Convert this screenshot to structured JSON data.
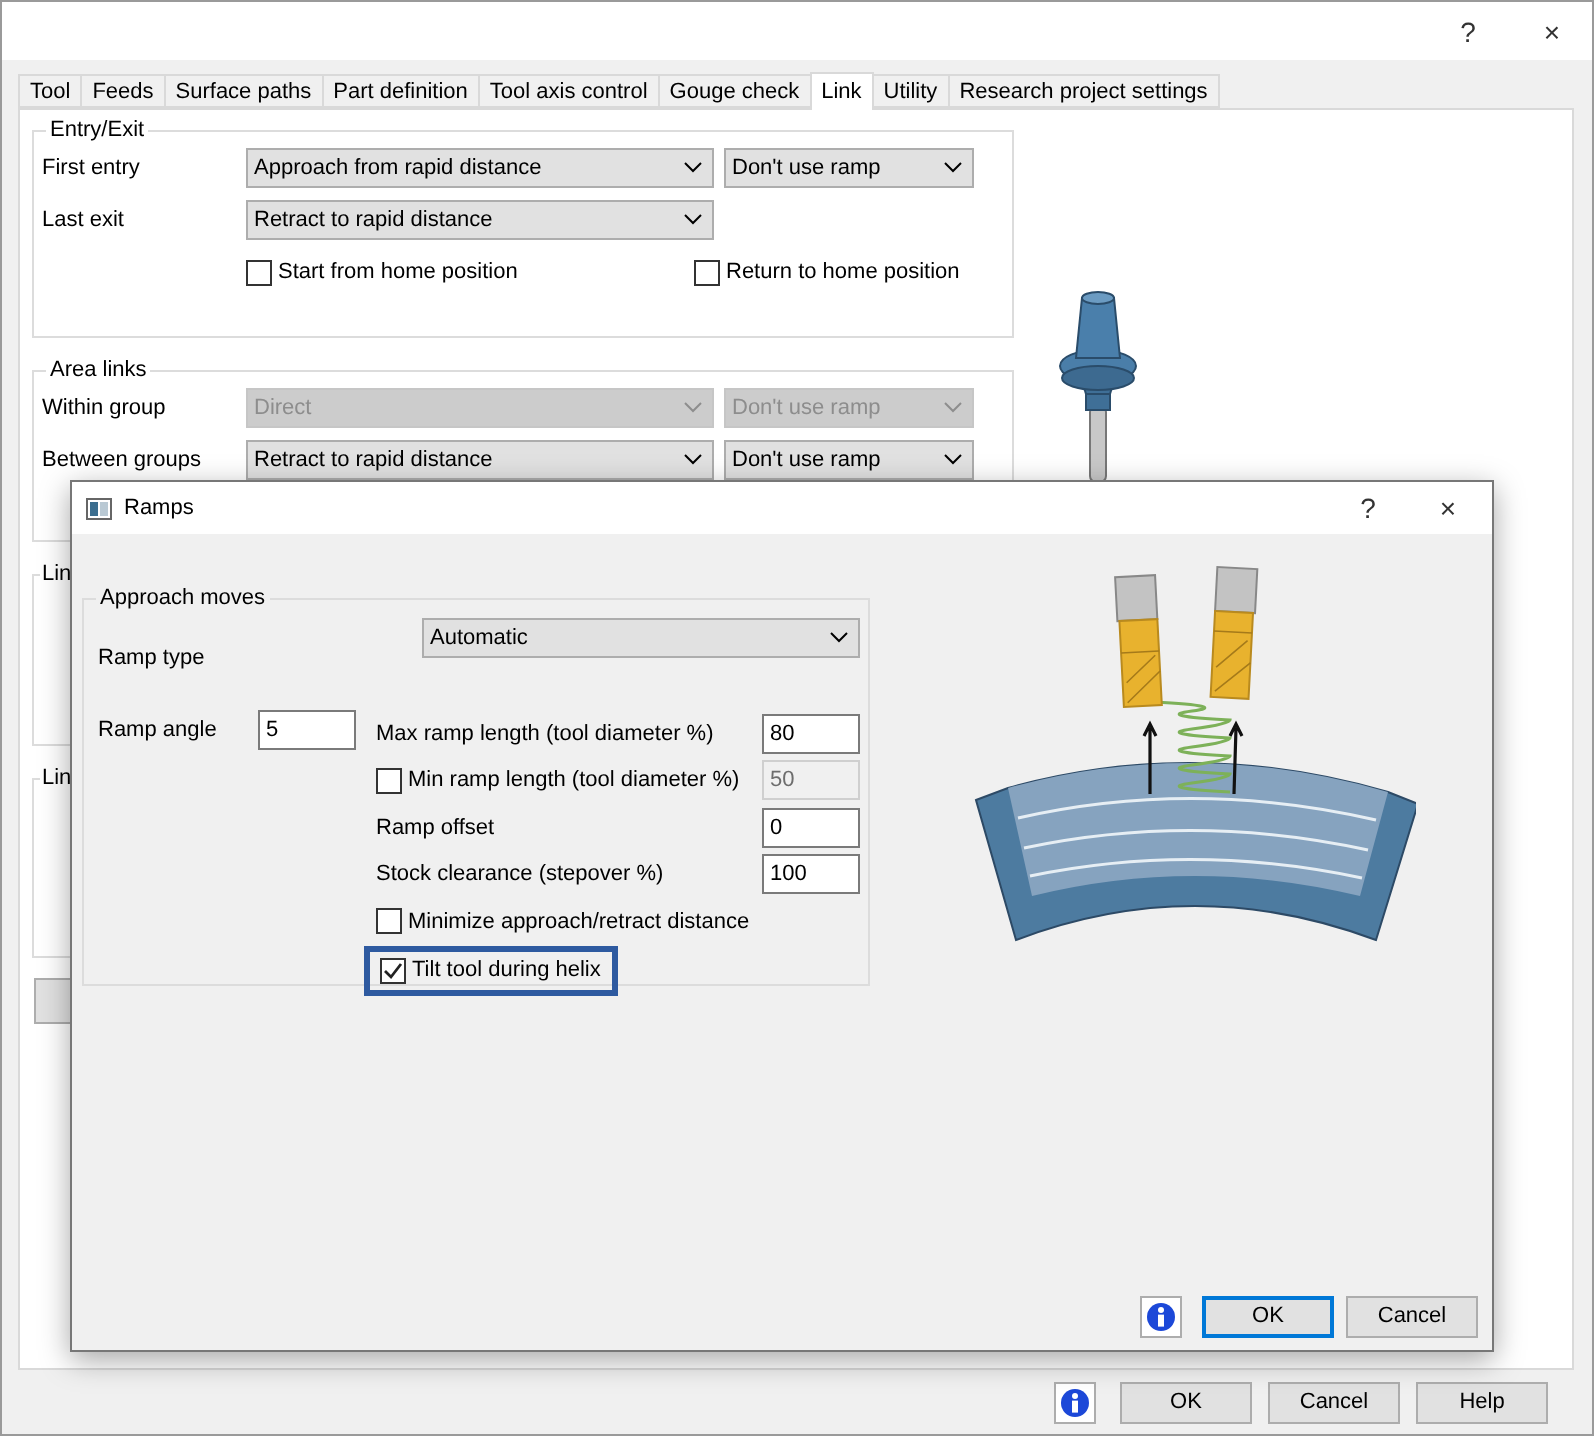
{
  "window": {
    "help": "?",
    "close": "×"
  },
  "tabs": [
    {
      "label": "Tool",
      "selected": false
    },
    {
      "label": "Feeds",
      "selected": false
    },
    {
      "label": "Surface paths",
      "selected": false
    },
    {
      "label": "Part definition",
      "selected": false
    },
    {
      "label": "Tool axis control",
      "selected": false
    },
    {
      "label": "Gouge check",
      "selected": false
    },
    {
      "label": "Link",
      "selected": true
    },
    {
      "label": "Utility",
      "selected": false
    },
    {
      "label": "Research project settings",
      "selected": false
    }
  ],
  "entry_exit": {
    "title": "Entry/Exit",
    "rows": [
      {
        "label": "First entry",
        "move": {
          "value": "Approach from rapid distance",
          "disabled": false
        },
        "ramp": {
          "value": "Don't use ramp",
          "disabled": false
        }
      },
      {
        "label": "Last exit",
        "move": {
          "value": "Retract to rapid distance",
          "disabled": false
        }
      }
    ],
    "checkboxes": [
      {
        "label": "Start from home position",
        "checked": false
      },
      {
        "label": "Return to home position",
        "checked": false
      }
    ]
  },
  "area_links": {
    "title": "Area links",
    "rows": [
      {
        "label": "Within group",
        "move": {
          "value": "Direct",
          "disabled": true
        },
        "ramp": {
          "value": "Don't use ramp",
          "disabled": true
        }
      },
      {
        "label": "Between groups",
        "move": {
          "value": "Retract to rapid distance",
          "disabled": false
        },
        "ramp": {
          "value": "Don't use ramp",
          "disabled": false
        }
      }
    ]
  },
  "partial_groups": [
    {
      "title": "Lin"
    },
    {
      "title": "Lin"
    }
  ],
  "footer_buttons": [
    {
      "label": "OK",
      "default": false
    },
    {
      "label": "Cancel",
      "default": false
    },
    {
      "label": "Help",
      "default": false
    }
  ],
  "ramps_dialog": {
    "title": "Ramps",
    "help": "?",
    "close": "×",
    "group_title": "Approach moves",
    "ramp_type": {
      "label": "Ramp type",
      "value": "Automatic"
    },
    "ramp_angle": {
      "label": "Ramp angle",
      "value": "5"
    },
    "fields": [
      {
        "kind": "field",
        "label": "Max ramp length (tool diameter %)",
        "value": "80",
        "disabled": false
      },
      {
        "kind": "checkfield",
        "label": "Min ramp length (tool diameter %)",
        "checked": false,
        "value": "50",
        "disabled": true
      },
      {
        "kind": "field",
        "label": "Ramp offset",
        "value": "0",
        "disabled": false
      },
      {
        "kind": "field",
        "label": "Stock clearance (stepover %)",
        "value": "100",
        "disabled": false
      },
      {
        "kind": "check",
        "label": "Minimize approach/retract distance",
        "checked": false,
        "highlighted": false
      },
      {
        "kind": "check",
        "label": "Tilt tool during helix",
        "checked": true,
        "highlighted": true
      }
    ],
    "buttons": [
      {
        "label": "OK",
        "default": true
      },
      {
        "label": "Cancel",
        "default": false
      }
    ]
  }
}
